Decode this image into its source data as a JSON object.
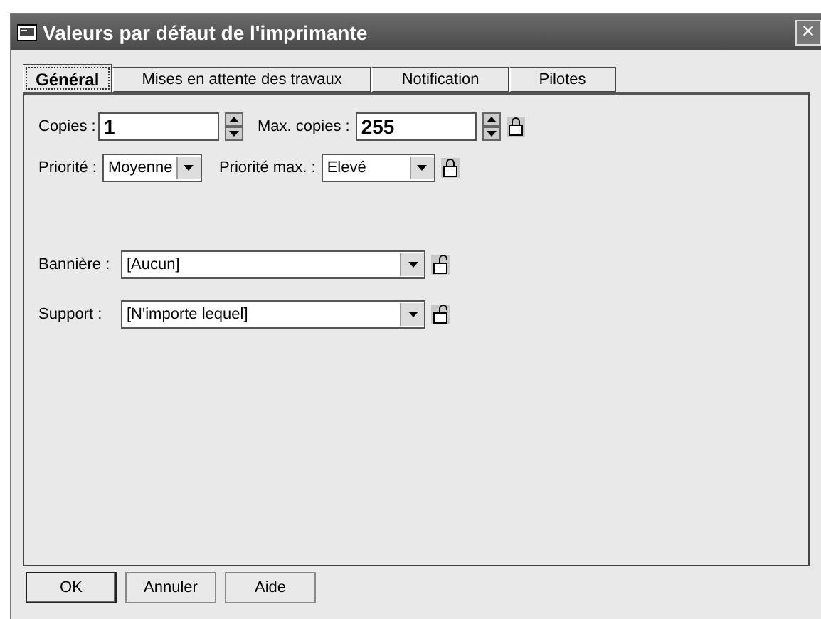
{
  "window": {
    "title": "Valeurs par défaut de l'imprimante",
    "close": "×"
  },
  "tabs": [
    {
      "label": "Général",
      "selected": true
    },
    {
      "label": "Mises en attente des travaux",
      "selected": false
    },
    {
      "label": "Notification",
      "selected": false
    },
    {
      "label": "Pilotes",
      "selected": false
    }
  ],
  "copies": {
    "label": "Copies :",
    "value": "1"
  },
  "max_copies": {
    "label": "Max. copies :",
    "value": "255",
    "locked": true
  },
  "priority": {
    "label": "Priorité :",
    "value": "Moyenne"
  },
  "max_priority": {
    "label": "Priorité max. :",
    "value": "Elevé",
    "locked": true
  },
  "banner": {
    "label": "Bannière :",
    "value": "[Aucun]",
    "locked": false
  },
  "media": {
    "label": "Support :",
    "value": "[N'importe lequel]",
    "locked": false
  },
  "buttons": [
    {
      "label": "OK",
      "default": true
    },
    {
      "label": "Annuler",
      "default": false
    },
    {
      "label": "Aide",
      "default": false
    }
  ]
}
